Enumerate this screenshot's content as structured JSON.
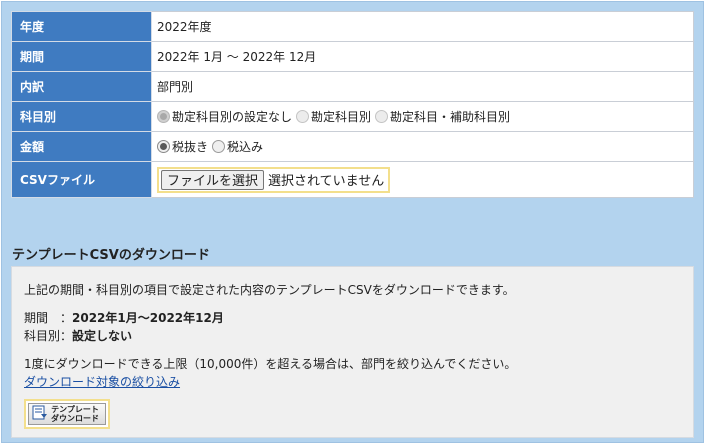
{
  "form": {
    "rows": {
      "year": {
        "label": "年度",
        "value": "2022年度"
      },
      "period": {
        "label": "期間",
        "value": "2022年 1月 ～ 2022年 12月"
      },
      "breakdown": {
        "label": "内訳",
        "value": "部門別"
      },
      "by_account": {
        "label": "科目別",
        "options": [
          "勘定科目別の設定なし",
          "勘定科目別",
          "勘定科目・補助科目別"
        ],
        "selected": "勘定科目別の設定なし"
      },
      "amount": {
        "label": "金額",
        "options": [
          "税抜き",
          "税込み"
        ],
        "selected": "税抜き"
      },
      "csv": {
        "label": "CSVファイル",
        "button": "ファイルを選択",
        "status": "選択されていません"
      }
    }
  },
  "download": {
    "title": "テンプレートCSVのダウンロード",
    "description": "上記の期間・科目別の項目で設定された内容のテンプレートCSVをダウンロードできます。",
    "period_label": "期間　：",
    "period_value": "2022年1月～2022年12月",
    "account_label": "科目別：",
    "account_value": "設定しない",
    "limit_note": "1度にダウンロードできる上限（10,000件）を超える場合は、部門を絞り込んでください。",
    "filter_link": "ダウンロード対象の絞り込み",
    "button_line1": "テンプレート",
    "button_line2": "ダウンロード"
  },
  "colors": {
    "header_bg": "#3f7bc1",
    "panel_bg": "#b3d3ee",
    "highlight": "#f3df8c",
    "link": "#1a4fa3"
  }
}
